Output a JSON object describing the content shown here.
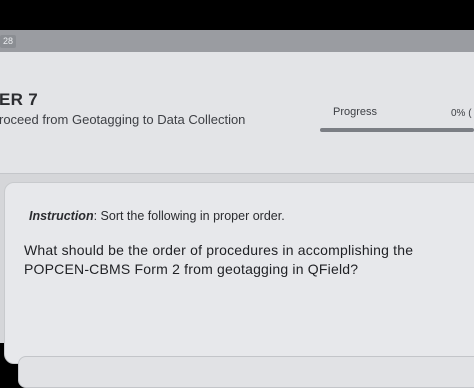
{
  "topbar": {
    "badge": "28"
  },
  "chapter": {
    "title": "ER 7",
    "subtitle": "roceed from Geotagging to Data Collection"
  },
  "progress": {
    "label": "Progress",
    "value_text": "0% (",
    "percent": 0
  },
  "question": {
    "instruction_label": "Instruction",
    "instruction_text": ": Sort the following in proper order.",
    "text": "What should be the order of procedures in accomplishing the POPCEN-CBMS Form 2 from geotagging in QField?"
  },
  "colors": {
    "background": "#d5d6d9",
    "header": "#e3e4e7",
    "card": "#e7e8eb"
  }
}
